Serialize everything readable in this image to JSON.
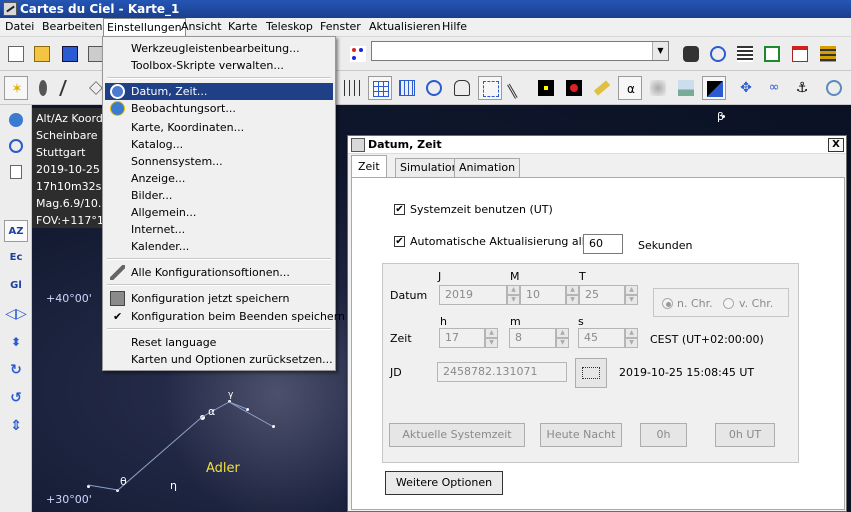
{
  "window": {
    "title": "Cartes du Ciel - Karte_1"
  },
  "menubar": [
    "Datei",
    "Bearbeiten",
    "Einstellungen",
    "Ansicht",
    "Karte",
    "Teleskop",
    "Fenster",
    "Aktualisieren",
    "Hilfe"
  ],
  "info": {
    "lines": [
      "Alt/Az Koord",
      "Scheinbare I",
      "Stuttgart",
      "2019-10-25",
      "17h10m32s",
      "Mag.6.9/10.5",
      "FOV:+117°1"
    ]
  },
  "skymap": {
    "labels": [
      "+40°00'",
      "+30°00'",
      "Adler",
      "α",
      "γ",
      "β",
      "θ",
      "η",
      "ζ"
    ]
  },
  "left_toolbar": {
    "eq": "EQ",
    "az": "AZ",
    "ec": "Ec",
    "gl": "Gl"
  },
  "dropdown": {
    "group1": [
      "Werkzeugleistenbearbeitung...",
      "Toolbox-Skripte verwalten..."
    ],
    "group2": [
      "Datum, Zeit...",
      "Beobachtungsort...",
      "Karte, Koordinaten...",
      "Katalog...",
      "Sonnensystem...",
      "Anzeige...",
      "Bilder...",
      "Allgemein...",
      "Internet...",
      "Kalender..."
    ],
    "all_options": "Alle Konfigurationsoftionen...",
    "save_now": "Konfiguration jetzt speichern",
    "save_on_exit": "Konfiguration beim Beenden speichern",
    "reset_language": "Reset language",
    "reset_maps": "Karten und Optionen zurücksetzen..."
  },
  "dialog": {
    "title": "Datum, Zeit",
    "close": "X",
    "tabs": [
      "Zeit",
      "Simulation",
      "Animation"
    ],
    "systemzeit_label": "Systemzeit benutzen (UT)",
    "auto_update_label": "Automatische Aktualisierung alle",
    "auto_update_value": "60",
    "seconds_label": "Sekunden",
    "date": {
      "label": "Datum",
      "headers": [
        "J",
        "M",
        "T"
      ],
      "year": "2019",
      "month": "10",
      "day": "25"
    },
    "era": {
      "nchr": "n. Chr.",
      "vchr": "v. Chr."
    },
    "time": {
      "label": "Zeit",
      "headers": [
        "h",
        "m",
        "s"
      ],
      "h": "17",
      "m": "8",
      "s": "45",
      "tz": "CEST (UT+02:00:00)"
    },
    "jd": {
      "label": "JD",
      "value": "2458782.131071",
      "readout": "2019-10-25 15:08:45 UT"
    },
    "buttons": {
      "current": "Aktuelle Systemzeit",
      "tonight": "Heute Nacht",
      "zero": "0h",
      "zero_ut": "0h UT",
      "more": "Weitere Optionen"
    }
  }
}
